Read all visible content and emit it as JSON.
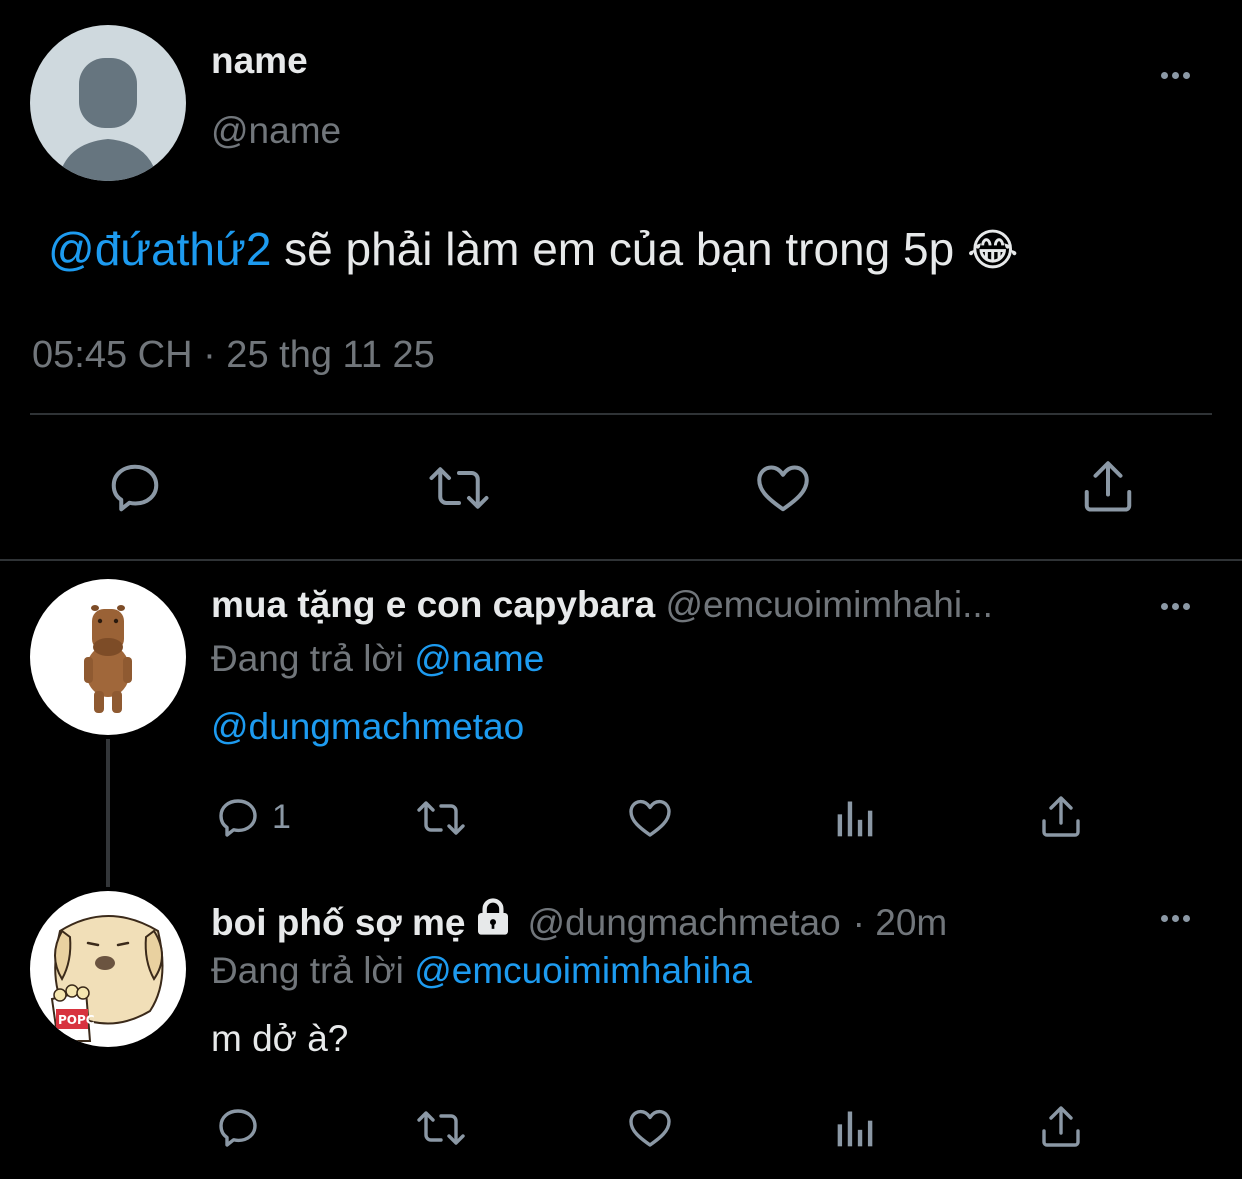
{
  "main_tweet": {
    "display_name": "name",
    "handle": "@name",
    "mention": "@đứathứ2",
    "text": " sẽ phải làm em của bạn trong 5p",
    "emoji": "😂",
    "timestamp": "05:45 CH · 25 thg 11 25",
    "actions": [
      "reply-icon",
      "retweet-icon",
      "like-icon",
      "share-icon"
    ]
  },
  "reply1": {
    "display_name": "mua tặng e con capybara",
    "handle": "@emcuoimimhahi...",
    "replying_prefix": "Đang trả lời",
    "replying_to": "@name",
    "text": "@dungmachmetao",
    "reply_count": "1"
  },
  "reply2": {
    "display_name": "boi phố sợ mẹ",
    "handle": "@dungmachmetao",
    "time": "· 20m",
    "replying_prefix": "Đang trả lời",
    "replying_to": "@emcuoimimhahiha",
    "text": "m dở à?"
  },
  "colors": {
    "background": "#000000",
    "text": "#e7e9ea",
    "secondary": "#71767b",
    "accent": "#1d9bf0",
    "divider": "#2f3336"
  }
}
